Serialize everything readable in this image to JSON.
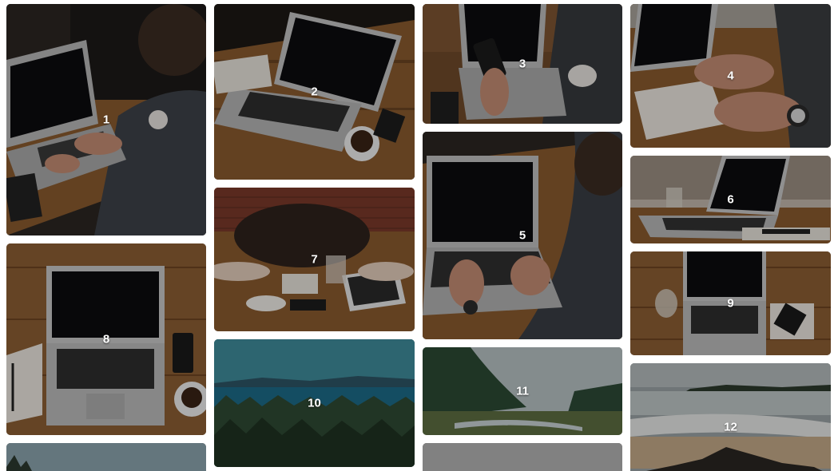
{
  "gallery": {
    "tiles": [
      {
        "label": "1"
      },
      {
        "label": "2"
      },
      {
        "label": "3"
      },
      {
        "label": "4"
      },
      {
        "label": "5"
      },
      {
        "label": "6"
      },
      {
        "label": "7"
      },
      {
        "label": "8"
      },
      {
        "label": "9"
      },
      {
        "label": "10"
      },
      {
        "label": "11"
      },
      {
        "label": "12"
      }
    ]
  },
  "colors": {
    "wood": "#8a5a2f",
    "laptop": "#b9b9b9",
    "screen": "#0c0c0e",
    "overlay": "rgba(0,0,0,0.28)",
    "label": "#ffffff"
  }
}
